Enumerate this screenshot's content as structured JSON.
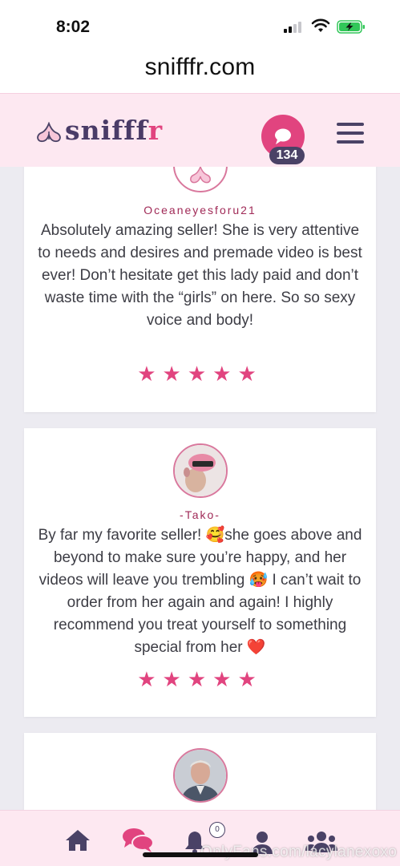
{
  "status_bar": {
    "time": "8:02",
    "battery_color": "#32c759"
  },
  "browser": {
    "url": "snifffr.com"
  },
  "header": {
    "logo_main": "snifff",
    "logo_accent": "r",
    "chat_badge_count": "134",
    "accent_color": "#e1447f",
    "dark_color": "#4a4266",
    "icons": [
      "logo-icon",
      "chat-bubble-icon",
      "hamburger-menu-icon"
    ]
  },
  "reviews": [
    {
      "reviewer": "Oceaneyesforu21",
      "text": "Absolutely amazing seller! She is very attentive to needs and desires and premade video is best ever! Don’t hesitate get this lady paid and don’t waste time with the “girls” on here. So so sexy voice and body!",
      "rating": 5,
      "stars": "★★★★★"
    },
    {
      "reviewer": "-Tako-",
      "text": "By far my favorite seller! 🥰she goes above and beyond to make sure you’re happy, and her videos will leave you trembling 🥵 I can’t wait to order from her again and again! I highly recommend you treat yourself to something special from her ❤️",
      "rating": 5,
      "stars": "★★★★★"
    },
    {
      "reviewer": "",
      "text": "",
      "rating": null,
      "stars": ""
    }
  ],
  "bottom_nav": {
    "items": [
      "home-icon",
      "chat-icon",
      "bell-icon",
      "user-icon",
      "users-icon"
    ],
    "notification_count": "0"
  },
  "watermark": "OnlyFans.com/lacylanexoxo"
}
